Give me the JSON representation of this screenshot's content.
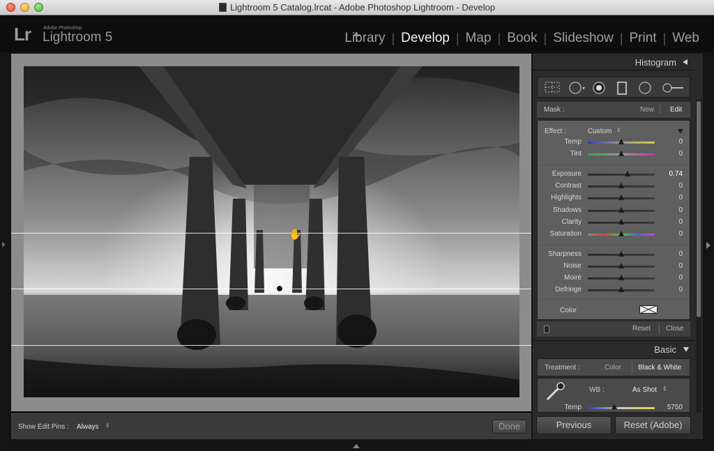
{
  "window": {
    "title": "Lightroom 5 Catalog.lrcat - Adobe Photoshop Lightroom - Develop"
  },
  "brand": {
    "logo": "Lr",
    "vendor": "Adobe Photoshop",
    "product": "Lightroom 5"
  },
  "modules": [
    "Library",
    "Develop",
    "Map",
    "Book",
    "Slideshow",
    "Print",
    "Web"
  ],
  "active_module": "Develop",
  "toolbar": {
    "show_edit_pins_label": "Show Edit Pins :",
    "show_edit_pins_value": "Always",
    "done_label": "Done"
  },
  "panel": {
    "histogram_label": "Histogram",
    "mask": {
      "label": "Mask :",
      "new": "New",
      "edit": "Edit"
    },
    "effect": {
      "label": "Effect :",
      "value": "Custom"
    },
    "sliders": [
      {
        "label": "Temp",
        "value": "0",
        "pos": 0.5,
        "style": "temp"
      },
      {
        "label": "Tint",
        "value": "0",
        "pos": 0.5,
        "style": "tint"
      },
      {
        "label": "Exposure",
        "value": "0.74",
        "pos": 0.59,
        "style": "gray"
      },
      {
        "label": "Contrast",
        "value": "0",
        "pos": 0.5,
        "style": "gray"
      },
      {
        "label": "Highlights",
        "value": "0",
        "pos": 0.5,
        "style": "gray"
      },
      {
        "label": "Shadows",
        "value": "0",
        "pos": 0.5,
        "style": "gray"
      },
      {
        "label": "Clarity",
        "value": "0",
        "pos": 0.5,
        "style": "gray"
      },
      {
        "label": "Saturation",
        "value": "0",
        "pos": 0.5,
        "style": "sat"
      },
      {
        "label": "Sharpness",
        "value": "0",
        "pos": 0.5,
        "style": "gray"
      },
      {
        "label": "Noise",
        "value": "0",
        "pos": 0.5,
        "style": "gray"
      },
      {
        "label": "Moiré",
        "value": "0",
        "pos": 0.5,
        "style": "gray"
      },
      {
        "label": "Defringe",
        "value": "0",
        "pos": 0.5,
        "style": "gray"
      }
    ],
    "color_label": "Color",
    "reset": "Reset",
    "close": "Close",
    "basic_label": "Basic",
    "treatment": {
      "label": "Treatment :",
      "color": "Color",
      "bw": "Black & White"
    },
    "wb": {
      "label": "WB :",
      "value": "As Shot"
    },
    "temp": {
      "label": "Temp",
      "value": "5750",
      "pos": 0.4
    }
  },
  "buttons": {
    "previous": "Previous",
    "reset_adobe": "Reset (Adobe)"
  },
  "colors": {
    "accent": "#e0e0e0",
    "panel": "#2a2a2a",
    "effect_bg": "#5f5f5f"
  }
}
